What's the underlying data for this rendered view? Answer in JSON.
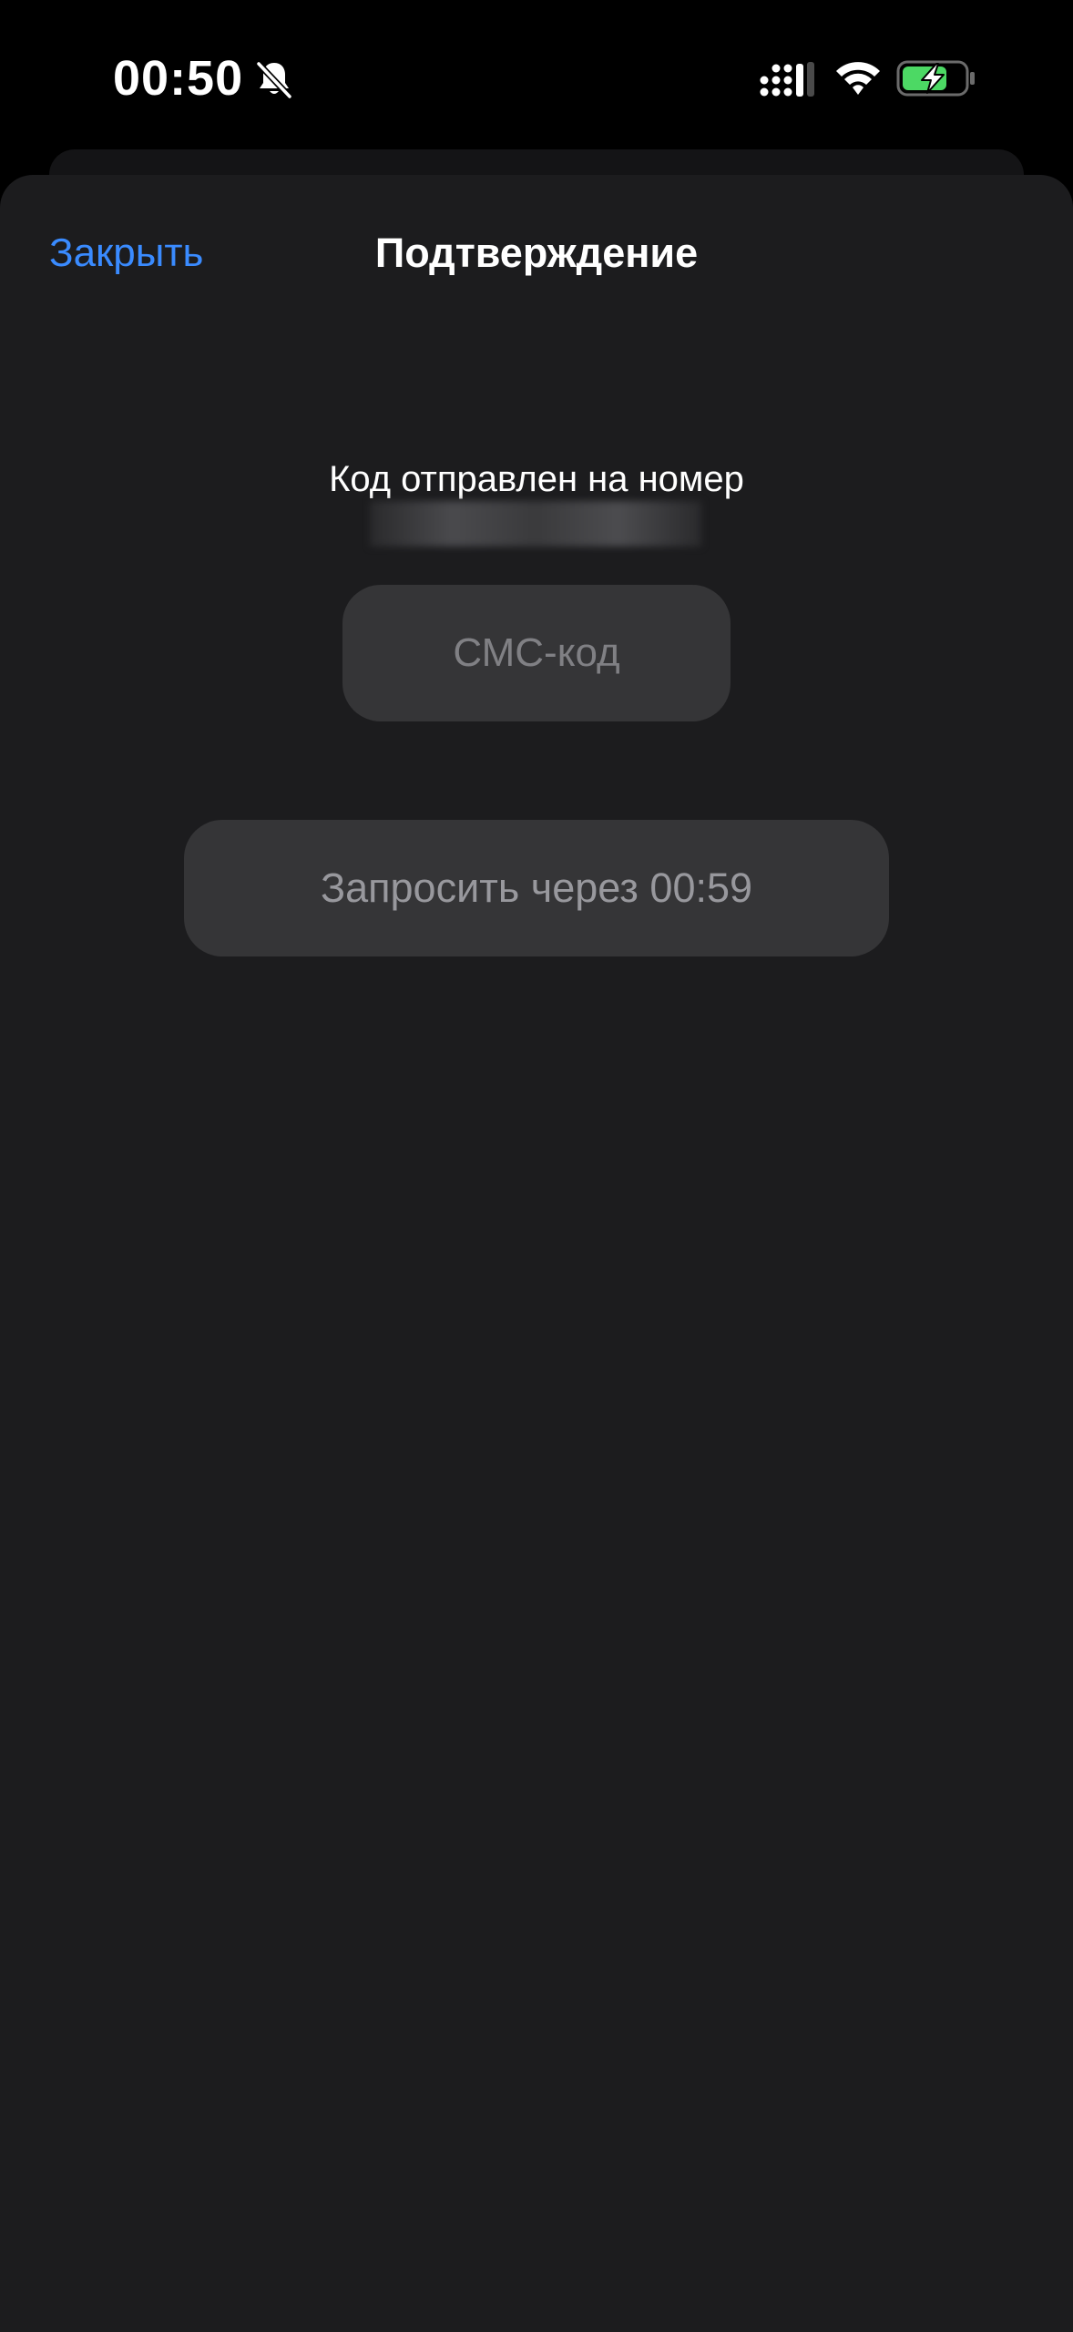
{
  "status_bar": {
    "time": "00:50",
    "icons": {
      "silent": "bell-slash-icon",
      "signal": "cellular-signal-icon",
      "wifi": "wifi-icon",
      "battery": "battery-charging-icon"
    },
    "battery_color": "#4cd964"
  },
  "nav": {
    "close_label": "Закрыть",
    "title": "Подтверждение"
  },
  "main": {
    "sent_label": "Код отправлен на номер",
    "sms_placeholder": "СМС-код",
    "sms_value": "",
    "resend_label": "Запросить через 00:59"
  },
  "colors": {
    "accent": "#3a8bff",
    "sheet_background": "#1c1c1e",
    "control_background": "#353537"
  }
}
